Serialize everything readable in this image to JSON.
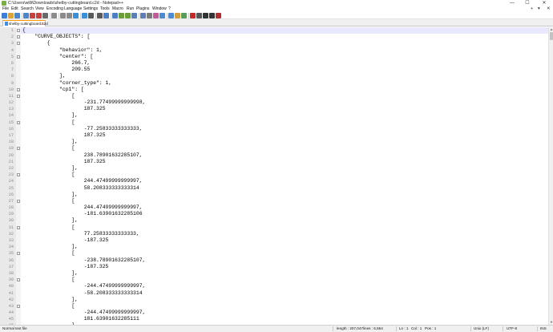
{
  "window": {
    "title": "C:\\Users\\willi\\Downloads\\shelby-cuttingboard.c2d - Notepad++",
    "minimize_glyph": "—",
    "maximize_glyph": "☐",
    "close_glyph": "✕"
  },
  "menu": {
    "items": [
      "File",
      "Edit",
      "Search",
      "View",
      "Encoding",
      "Language",
      "Settings",
      "Tools",
      "Macro",
      "Run",
      "Plugins",
      "Window",
      "?"
    ],
    "right_add": "+",
    "right_down": "▾",
    "right_close": "✕"
  },
  "toolbar": {
    "icons": [
      "new-file-icon",
      "open-file-icon",
      "save-icon",
      "save-all-icon",
      "close-icon",
      "close-all-icon",
      "print-icon",
      "cut-icon",
      "copy-icon",
      "paste-icon",
      "undo-icon",
      "redo-icon",
      "find-icon",
      "replace-icon",
      "zoom-in-icon",
      "zoom-out-icon",
      "sync-v-icon",
      "sync-h-icon",
      "word-wrap-icon",
      "show-all-chars-icon",
      "indent-guide-icon",
      "udl-icon",
      "doc-map-icon",
      "function-list-icon",
      "folder-workspace-icon",
      "monitoring-icon",
      "record-macro-icon",
      "stop-macro-icon",
      "play-macro-icon",
      "run-macro-multiple-icon",
      "save-macro-icon"
    ]
  },
  "tabs": [
    {
      "label": "shelby-cuttingboard.c2d",
      "close": "✕"
    }
  ],
  "editor": {
    "lines": [
      {
        "n": "1",
        "text": "{",
        "fold": "-"
      },
      {
        "n": "2",
        "text": "    \"CURVE_OBJECTS\": [",
        "fold": "-"
      },
      {
        "n": "3",
        "text": "        {",
        "fold": "-"
      },
      {
        "n": "4",
        "text": "            \"behavior\": 1,",
        "fold": ""
      },
      {
        "n": "5",
        "text": "            \"center\": [",
        "fold": "-"
      },
      {
        "n": "6",
        "text": "                266.7,",
        "fold": ""
      },
      {
        "n": "7",
        "text": "                209.55",
        "fold": ""
      },
      {
        "n": "8",
        "text": "            ],",
        "fold": ""
      },
      {
        "n": "9",
        "text": "            \"corner_type\": 1,",
        "fold": ""
      },
      {
        "n": "10",
        "text": "            \"cp1\": [",
        "fold": "-"
      },
      {
        "n": "11",
        "text": "                [",
        "fold": "-"
      },
      {
        "n": "12",
        "text": "                    -231.77499999999998,",
        "fold": ""
      },
      {
        "n": "13",
        "text": "                    187.325",
        "fold": ""
      },
      {
        "n": "14",
        "text": "                ],",
        "fold": ""
      },
      {
        "n": "15",
        "text": "                [",
        "fold": "-"
      },
      {
        "n": "16",
        "text": "                    -77.25833333333333,",
        "fold": ""
      },
      {
        "n": "17",
        "text": "                    187.325",
        "fold": ""
      },
      {
        "n": "18",
        "text": "                ],",
        "fold": ""
      },
      {
        "n": "19",
        "text": "                [",
        "fold": "-"
      },
      {
        "n": "20",
        "text": "                    238.78901632285107,",
        "fold": ""
      },
      {
        "n": "21",
        "text": "                    187.325",
        "fold": ""
      },
      {
        "n": "22",
        "text": "                ],",
        "fold": ""
      },
      {
        "n": "23",
        "text": "                [",
        "fold": "-"
      },
      {
        "n": "24",
        "text": "                    244.47499999999997,",
        "fold": ""
      },
      {
        "n": "25",
        "text": "                    58.208333333333314",
        "fold": ""
      },
      {
        "n": "26",
        "text": "                ],",
        "fold": ""
      },
      {
        "n": "27",
        "text": "                [",
        "fold": "-"
      },
      {
        "n": "28",
        "text": "                    244.47499999999997,",
        "fold": ""
      },
      {
        "n": "29",
        "text": "                    -181.63901632285106",
        "fold": ""
      },
      {
        "n": "30",
        "text": "                ],",
        "fold": ""
      },
      {
        "n": "31",
        "text": "                [",
        "fold": "-"
      },
      {
        "n": "32",
        "text": "                    77.25833333333333,",
        "fold": ""
      },
      {
        "n": "33",
        "text": "                    -187.325",
        "fold": ""
      },
      {
        "n": "34",
        "text": "                ],",
        "fold": ""
      },
      {
        "n": "35",
        "text": "                [",
        "fold": "-"
      },
      {
        "n": "36",
        "text": "                    -238.78901632285107,",
        "fold": ""
      },
      {
        "n": "37",
        "text": "                    -187.325",
        "fold": ""
      },
      {
        "n": "38",
        "text": "                ],",
        "fold": ""
      },
      {
        "n": "39",
        "text": "                [",
        "fold": "-"
      },
      {
        "n": "40",
        "text": "                    -244.47499999999997,",
        "fold": ""
      },
      {
        "n": "41",
        "text": "                    -58.208333333333314",
        "fold": ""
      },
      {
        "n": "42",
        "text": "                ],",
        "fold": ""
      },
      {
        "n": "43",
        "text": "                [",
        "fold": "-"
      },
      {
        "n": "44",
        "text": "                    -244.47499999999997,",
        "fold": ""
      },
      {
        "n": "45",
        "text": "                    181.63901632285111",
        "fold": ""
      },
      {
        "n": "46",
        "text": "                ],",
        "fold": ""
      }
    ]
  },
  "status": {
    "file_type": "Normal text file",
    "length": "length : 207,047",
    "lines": "lines : 6,554",
    "ln": "Ln : 1",
    "col": "Col : 1",
    "pos": "Pos : 1",
    "eol": "Unix (LF)",
    "encoding": "UTF-8",
    "mode": "INS"
  },
  "colors": {
    "active_line": "#e8e8ff",
    "tab_accent": "#ff9a00",
    "gutter": "#e9e9e9"
  }
}
